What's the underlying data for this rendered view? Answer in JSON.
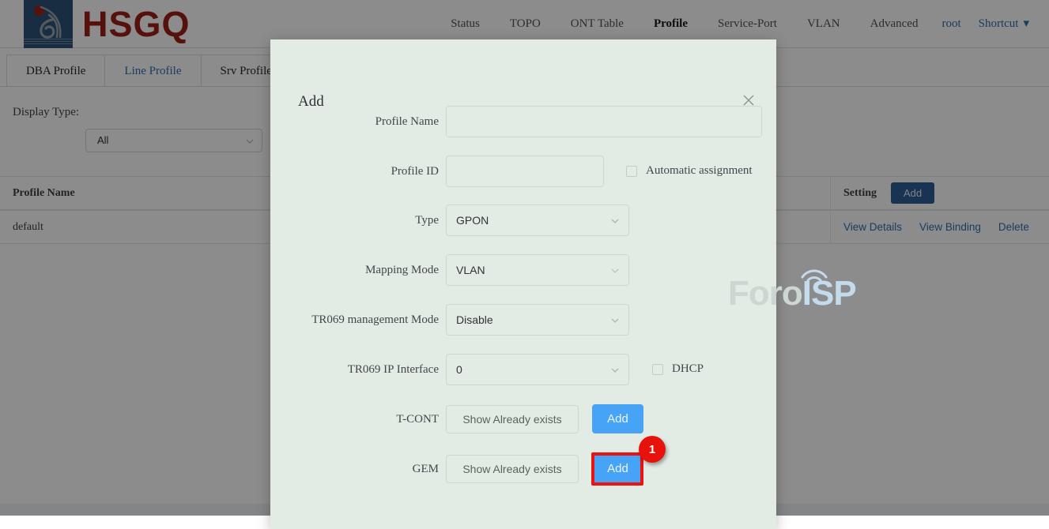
{
  "brand": {
    "name": "HSGQ",
    "logo_icon": "hsgq-flame-logo"
  },
  "nav": {
    "items": [
      {
        "label": "Status",
        "active": false
      },
      {
        "label": "TOPO",
        "active": false
      },
      {
        "label": "ONT Table",
        "active": false
      },
      {
        "label": "Profile",
        "active": true
      },
      {
        "label": "Service-Port",
        "active": false
      },
      {
        "label": "VLAN",
        "active": false
      },
      {
        "label": "Advanced",
        "active": false
      }
    ],
    "user": "root",
    "shortcut": "Shortcut",
    "shortcut_icon": "chevron-down-icon"
  },
  "tabs": [
    {
      "label": "DBA Profile",
      "active": false
    },
    {
      "label": "Line Profile",
      "active": true
    },
    {
      "label": "Srv Profile",
      "active": false
    }
  ],
  "filter": {
    "label": "Display Type:",
    "value": "All",
    "chevron_icon": "chevron-down-icon"
  },
  "table": {
    "headers": [
      "Profile Name",
      "Setting"
    ],
    "add_button": "Add",
    "rows": [
      {
        "profile_name": "default",
        "actions": [
          "View Details",
          "View Binding",
          "Delete"
        ]
      }
    ]
  },
  "watermark": {
    "part1": "Foro",
    "part2": "ISP"
  },
  "modal": {
    "title": "Add",
    "close_icon": "close-icon",
    "fields": {
      "profile_name": {
        "label": "Profile Name",
        "value": "",
        "placeholder": ""
      },
      "profile_id": {
        "label": "Profile ID",
        "value": "",
        "placeholder": ""
      },
      "automatic_assignment": {
        "label": "Automatic assignment",
        "checked": false
      },
      "type": {
        "label": "Type",
        "value": "GPON",
        "chevron_icon": "chevron-down-icon"
      },
      "mapping_mode": {
        "label": "Mapping Mode",
        "value": "VLAN",
        "chevron_icon": "chevron-down-icon"
      },
      "tr069_management_mode": {
        "label": "TR069 management Mode",
        "value": "Disable",
        "chevron_icon": "chevron-down-icon"
      },
      "tr069_ip_interface": {
        "label": "TR069 IP Interface",
        "value": "0",
        "chevron_icon": "chevron-down-icon"
      },
      "dhcp": {
        "label": "DHCP",
        "checked": false
      },
      "tcont": {
        "label": "T-CONT",
        "show_button": "Show Already exists",
        "add_button": "Add"
      },
      "gem": {
        "label": "GEM",
        "show_button": "Show Already exists",
        "add_button": "Add"
      }
    }
  },
  "annotation": {
    "badge": "1",
    "color": "#ee1111"
  }
}
